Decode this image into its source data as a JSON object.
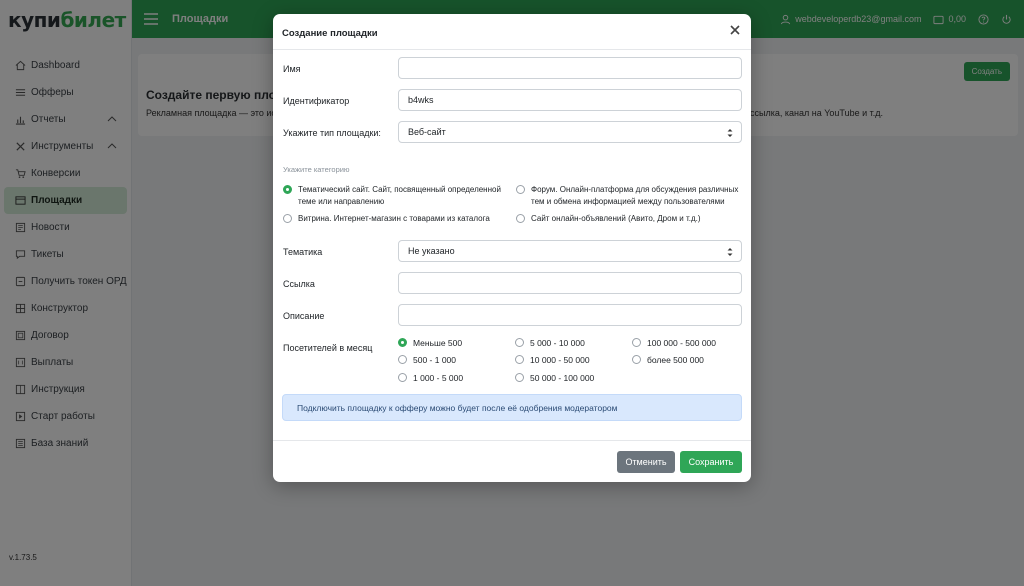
{
  "brand": {
    "part1": "купи",
    "part2": "билет"
  },
  "sidebar": {
    "items": [
      {
        "label": "Dashboard",
        "icon": "home-icon"
      },
      {
        "label": "Офферы",
        "icon": "list-icon"
      },
      {
        "label": "Отчеты",
        "icon": "chart-icon",
        "expandable": true
      },
      {
        "label": "Инструменты",
        "icon": "tools-icon",
        "expandable": true
      },
      {
        "label": "Конверсии",
        "icon": "cart-icon"
      },
      {
        "label": "Площадки",
        "icon": "window-icon",
        "active": true
      },
      {
        "label": "Новости",
        "icon": "news-icon"
      },
      {
        "label": "Тикеты",
        "icon": "chat-icon"
      },
      {
        "label": "Получить токен ОРД",
        "icon": "token-icon"
      },
      {
        "label": "Конструктор",
        "icon": "grid-icon"
      },
      {
        "label": "Договор",
        "icon": "contract-icon"
      },
      {
        "label": "Выплаты",
        "icon": "wallet-icon"
      },
      {
        "label": "Инструкция",
        "icon": "book-icon"
      },
      {
        "label": "Старт работы",
        "icon": "start-icon"
      },
      {
        "label": "База знаний",
        "icon": "database-icon"
      }
    ],
    "version": "v.1.73.5"
  },
  "header": {
    "title": "Площадки",
    "email": "webdeveloperdb23@gmail.com",
    "balance": "0,00"
  },
  "card": {
    "title": "Создайте первую площад",
    "text_left": "Рекламная площадка — это ист",
    "text_right": "а, рассылка, канал на YouTube и т.д.",
    "create_button": "Создать"
  },
  "modal": {
    "title": "Создание площадки",
    "fields": {
      "name_label": "Имя",
      "name_value": "",
      "id_label": "Идентификатор",
      "id_value": "b4wks",
      "type_label": "Укажите тип площадки:",
      "type_value": "Веб-сайт",
      "category_hint": "Укажите категорию",
      "theme_label": "Тематика",
      "theme_value": "Не указано",
      "link_label": "Ссылка",
      "link_value": "",
      "description_label": "Описание",
      "description_value": "",
      "visitors_label": "Посетителей в месяц"
    },
    "categories": [
      {
        "line1": "Тематический сайт. Сайт, посвященный определенной",
        "line2": "теме или направлению",
        "selected": true
      },
      {
        "line1": "Форум. Онлайн-платформа для обсуждения различных",
        "line2": "тем и обмена информацией между пользователями",
        "selected": false
      },
      {
        "line1": "Витрина. Интернет-магазин с товарами из каталога",
        "line2": "",
        "selected": false
      },
      {
        "line1": "Сайт онлайн-объявлений (Авито, Дром и т.д.)",
        "line2": "",
        "selected": false
      }
    ],
    "visitors": [
      {
        "label": "Меньше 500",
        "selected": true
      },
      {
        "label": "500 - 1 000",
        "selected": false
      },
      {
        "label": "1 000 - 5 000",
        "selected": false
      },
      {
        "label": "5 000 - 10 000",
        "selected": false
      },
      {
        "label": "10 000 - 50 000",
        "selected": false
      },
      {
        "label": "50 000 - 100 000",
        "selected": false
      },
      {
        "label": "100 000 - 500 000",
        "selected": false
      },
      {
        "label": "более 500 000",
        "selected": false
      }
    ],
    "alert": "Подключить площадку к офферу можно будет после её одобрения модератором",
    "cancel_button": "Отменить",
    "save_button": "Сохранить"
  },
  "colors": {
    "accent": "#2fa657",
    "cancel": "#6c757d",
    "alert_bg": "#d9e8fd"
  }
}
